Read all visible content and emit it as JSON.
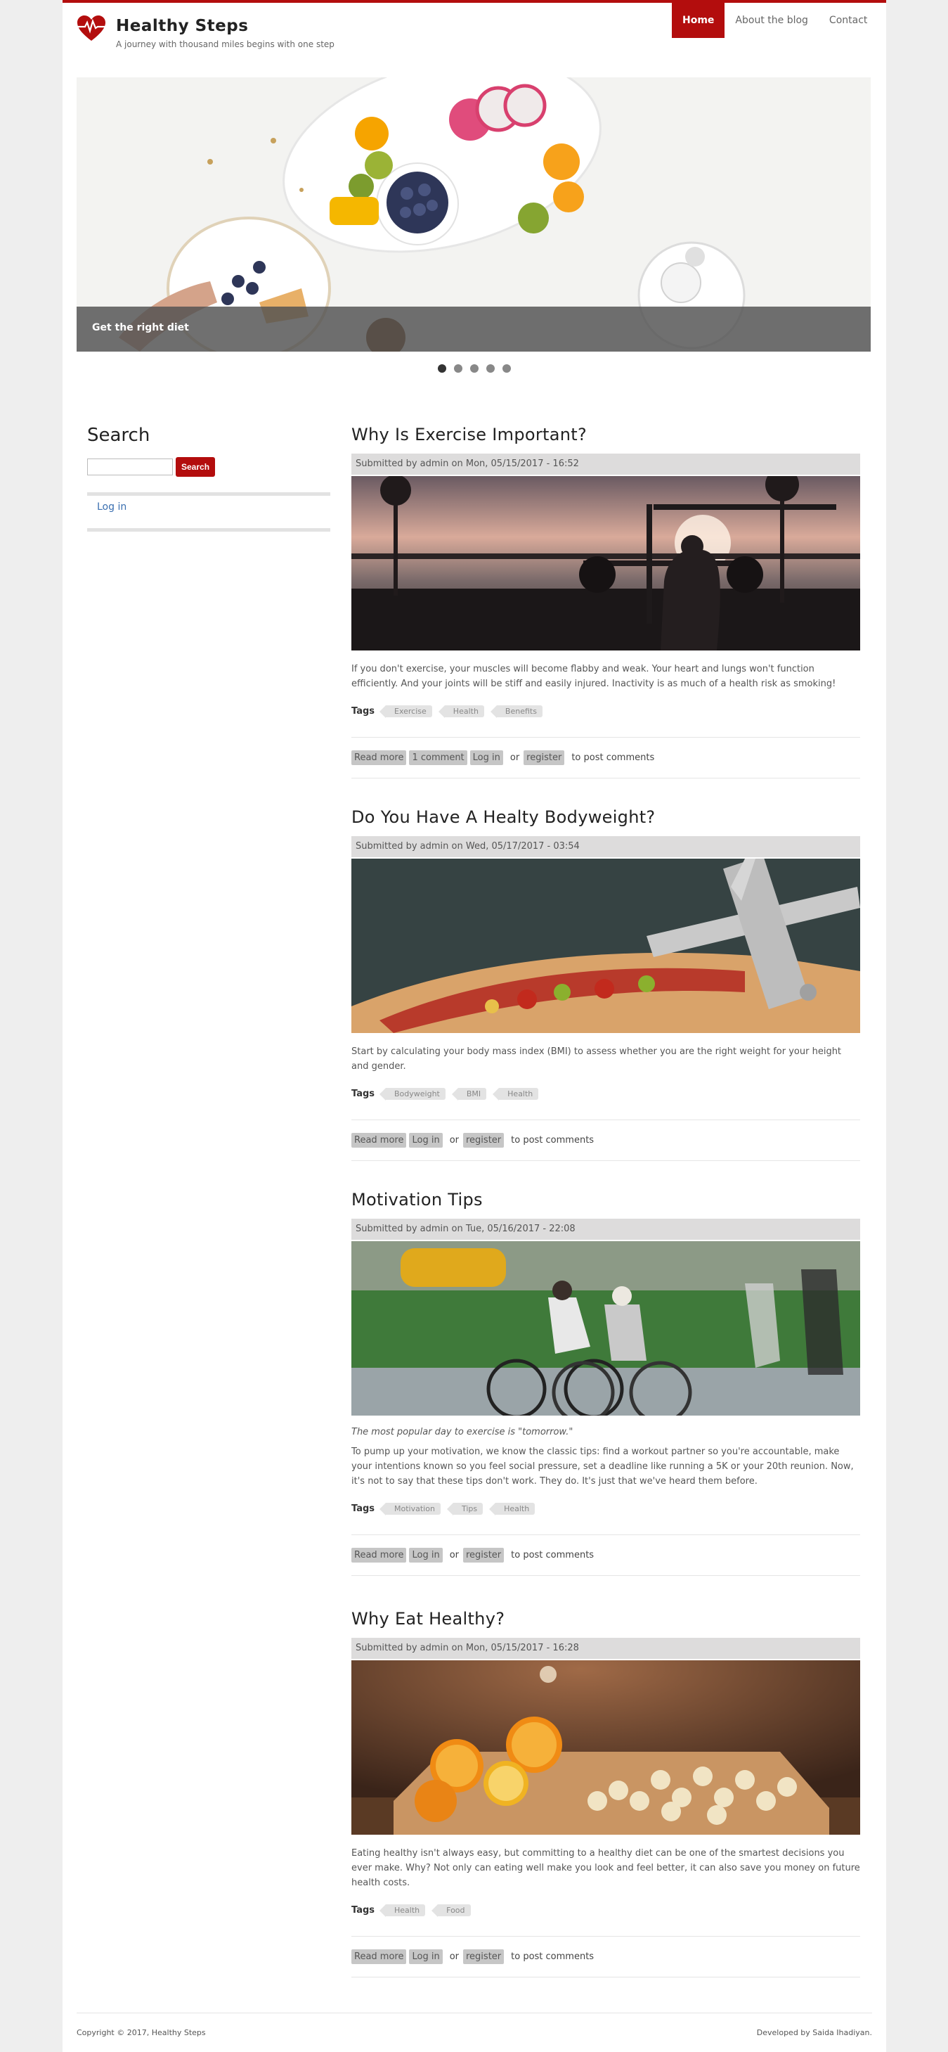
{
  "site": {
    "name": "Healthy Steps",
    "slogan": "A journey with thousand miles begins with one step",
    "accent": "#b30d0d"
  },
  "nav": {
    "items": [
      {
        "label": "Home",
        "active": true
      },
      {
        "label": "About the blog"
      },
      {
        "label": "Contact"
      }
    ]
  },
  "slider": {
    "caption": "Get the right diet",
    "slides": 5,
    "current": 1
  },
  "sidebar": {
    "search_title": "Search",
    "search_button": "Search",
    "search_value": "",
    "login_link": "Log in"
  },
  "articles": [
    {
      "title": "Why Is Exercise Important?",
      "meta": "Submitted by admin on Mon, 05/15/2017 - 16:52",
      "image": "gym-silhouette-photo",
      "quote": "",
      "teaser": "If you don't exercise, your muscles will become flabby and weak. Your heart and lungs won't function efficiently. And your joints will be stiff and easily injured. Inactivity is as much of a health risk as smoking!",
      "tags_label": "Tags",
      "tags": [
        "Exercise",
        "Health",
        "Benefits"
      ],
      "links": [
        "Read more",
        "1 comment",
        "Log in",
        "or",
        "register",
        "to post comments"
      ]
    },
    {
      "title": "Do You Have A Healty Bodyweight?",
      "meta": "Submitted by admin on Wed, 05/17/2017 - 03:54",
      "image": "sandwich-caliper-photo",
      "quote": "",
      "teaser": "Start by calculating your body mass index (BMI) to assess whether you are the right weight for your height and gender.",
      "tags_label": "Tags",
      "tags": [
        "Bodyweight",
        "BMI",
        "Health"
      ],
      "links": [
        "Read more",
        "Log in",
        "or",
        "register",
        "to post comments"
      ]
    },
    {
      "title": "Motivation Tips",
      "meta": "Submitted by admin on Tue, 05/16/2017 - 22:08",
      "image": "cyclists-photo",
      "quote": "The most popular day to exercise is \"tomorrow.\"",
      "teaser": "To pump up your motivation, we know the classic tips: find a workout partner so you're accountable, make your intentions known so you feel social pressure, set a deadline like running a 5K or your 20th reunion. Now, it's not to say that these tips don't work. They do. It's just that we've heard them before.",
      "tags_label": "Tags",
      "tags": [
        "Motivation",
        "Tips",
        "Health"
      ],
      "links": [
        "Read more",
        "Log in",
        "or",
        "register",
        "to post comments"
      ]
    },
    {
      "title": "Why Eat Healthy?",
      "meta": "Submitted by admin on Mon, 05/15/2017 - 16:28",
      "image": "oranges-bananas-photo",
      "quote": "",
      "teaser": "Eating healthy isn't always easy, but committing to a healthy diet can be one of the smartest decisions you ever make. Why? Not only can eating well make you look and feel better, it can also save you money on future health costs.",
      "tags_label": "Tags",
      "tags": [
        "Health",
        "Food"
      ],
      "links": [
        "Read more",
        "Log in",
        "or",
        "register",
        "to post comments"
      ]
    }
  ],
  "footer": {
    "copyright": "Copyright © 2017, Healthy Steps",
    "credit": "Developed by Saida Ihadiyan."
  }
}
